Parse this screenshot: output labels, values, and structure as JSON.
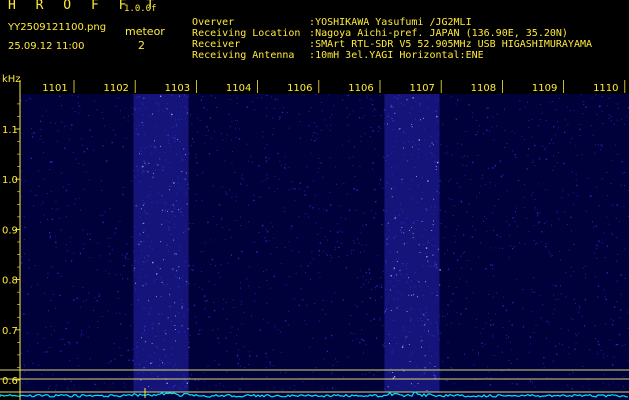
{
  "header": {
    "app_title": "H R O F F T",
    "version": "1.0.0f",
    "file_name": "YY2509121100.png",
    "date_time": "25.09.12 11:00",
    "mode_label": "meteor",
    "meteor_count": "2"
  },
  "station_info": [
    {
      "label": "Overver",
      "value": ":YOSHIKAWA Yasufumi /JG2MLI"
    },
    {
      "label": "Receiving Location",
      "value": ":Nagoya Aichi-pref. JAPAN (136.90E, 35.20N)"
    },
    {
      "label": "Receiver",
      "value": ":SMArt RTL-SDR V5 52.905MHz USB HIGASHIMURAYAMA"
    },
    {
      "label": "Receiving Antenna",
      "value": ":10mH 3el.YAGI Horizontal:ENE"
    }
  ],
  "spectrogram": {
    "y_unit": "kHz",
    "y_ticks": [
      "1.1",
      "1.0",
      "0.9",
      "0.8",
      "0.7",
      "0.6"
    ],
    "y_tick_values": [
      1.1,
      1.0,
      0.9,
      0.8,
      0.7,
      0.6
    ],
    "y_range": [
      0.58,
      1.2
    ],
    "time_labels": [
      "1101",
      "1102",
      "1103",
      "1104",
      "1106",
      "1106",
      "1107",
      "1108",
      "1109",
      "1110"
    ],
    "active_bands": [
      {
        "start_label": "1102",
        "end_label": "1103",
        "start_frac": 0.5,
        "end_frac": 1.2
      },
      {
        "start_label": "1106",
        "end_label": "1107",
        "start_frac": 0.7,
        "end_frac": 1.0
      }
    ],
    "background_color": "#00003a",
    "noise_color": "#3a3aff",
    "trace_color": "#00e5ff",
    "guide_color": "#d8d870",
    "guide_levels_khz": [
      0.62,
      0.6
    ]
  }
}
